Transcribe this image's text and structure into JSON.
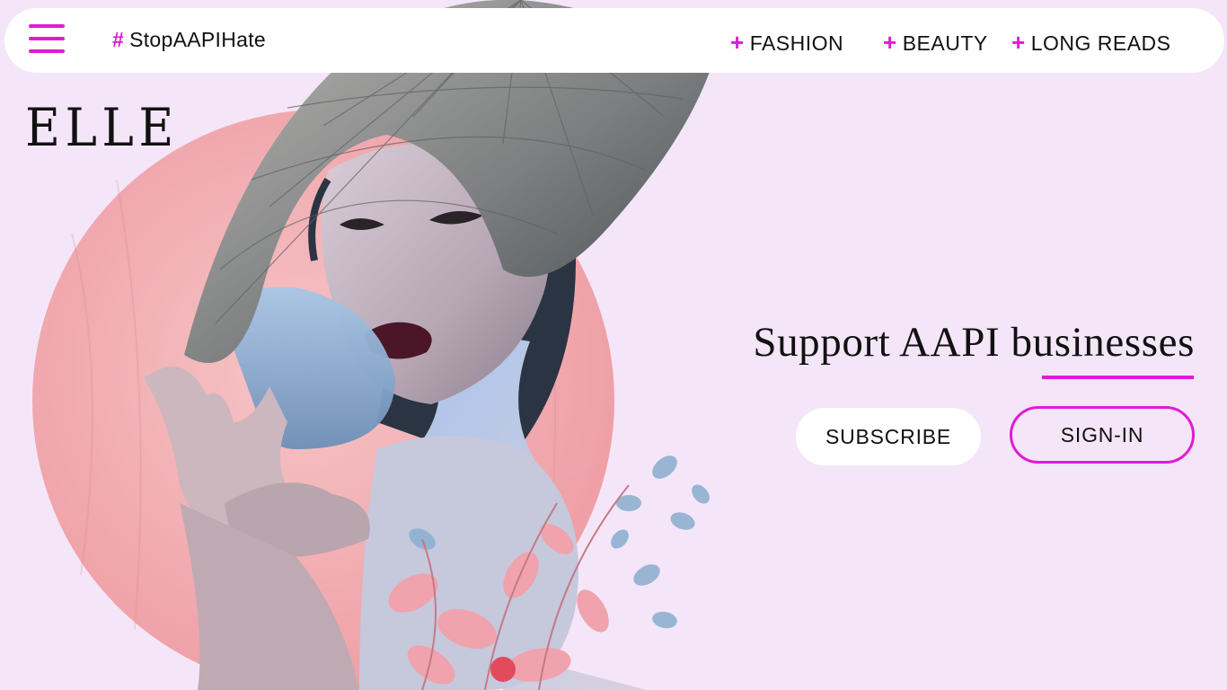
{
  "nav": {
    "menu_icon": "hamburger-menu-icon",
    "hashtag_symbol": "#",
    "hashtag_text": "StopAAPIHate",
    "plus_symbol": "+",
    "items": [
      {
        "label": "FASHION"
      },
      {
        "label": "BEAUTY"
      },
      {
        "label": "LONG READS"
      }
    ]
  },
  "brand": {
    "logo": "ELLE"
  },
  "hero": {
    "headline": "Support AAPI businesses",
    "subscribe_label": "SUBSCRIBE",
    "signin_label": "SIGN-IN"
  },
  "colors": {
    "accent": "#e11ad4",
    "background": "#f4e6f8",
    "circle": "#f2b3b8"
  }
}
